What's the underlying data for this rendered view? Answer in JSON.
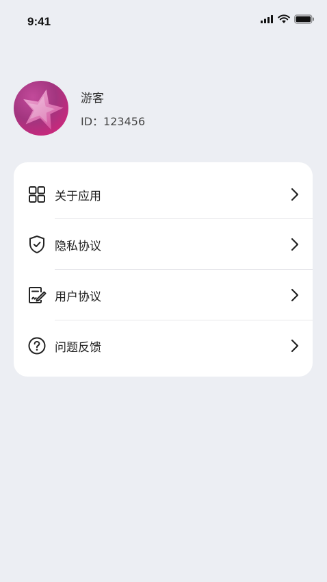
{
  "status_bar": {
    "time": "9:41",
    "icons": [
      "signal-icon",
      "wifi-icon",
      "battery-icon"
    ]
  },
  "profile": {
    "name": "游客",
    "id_text": "ID：123456",
    "avatar_icon": "star-avatar-icon"
  },
  "menu": {
    "items": [
      {
        "label": "关于应用",
        "icon": "grid-apps-icon"
      },
      {
        "label": "隐私协议",
        "icon": "shield-check-icon"
      },
      {
        "label": "用户协议",
        "icon": "document-sign-icon"
      },
      {
        "label": "问题反馈",
        "icon": "question-circle-icon"
      }
    ]
  },
  "colors": {
    "background": "#eceef3",
    "card": "#ffffff",
    "text": "#222222",
    "avatar_primary": "#a2357f",
    "avatar_accent": "#e0207a"
  }
}
